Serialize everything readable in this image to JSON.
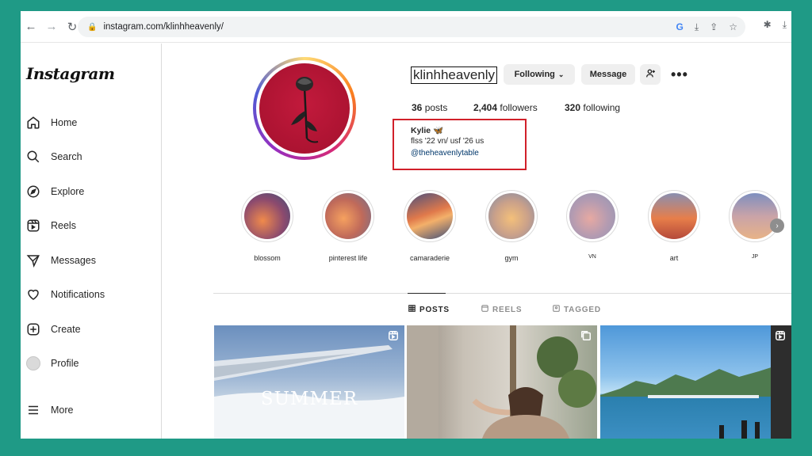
{
  "browser": {
    "url": "instagram.com/klinhheavenly/"
  },
  "app": {
    "logo": "Instagram"
  },
  "sidebar": {
    "items": [
      {
        "label": "Home",
        "icon": "home-icon"
      },
      {
        "label": "Search",
        "icon": "search-icon"
      },
      {
        "label": "Explore",
        "icon": "compass-icon"
      },
      {
        "label": "Reels",
        "icon": "reels-icon"
      },
      {
        "label": "Messages",
        "icon": "send-icon"
      },
      {
        "label": "Notifications",
        "icon": "heart-icon"
      },
      {
        "label": "Create",
        "icon": "plus-square-icon"
      },
      {
        "label": "Profile",
        "icon": "avatar-icon"
      },
      {
        "label": "More",
        "icon": "menu-icon"
      }
    ]
  },
  "profile": {
    "username": "klinhheavenly",
    "following_button": "Following",
    "message_button": "Message",
    "posts_count": "36",
    "posts_label": "posts",
    "followers_count": "2,404",
    "followers_label": "followers",
    "following_count": "320",
    "following_label": "following",
    "bio_name": "Kylie 🦋",
    "bio_line": "flss '22 vn/ usf '26 us",
    "bio_link": "@theheavenlytable"
  },
  "highlights": [
    {
      "label": "blossom"
    },
    {
      "label": "pinterest life"
    },
    {
      "label": "camaraderie"
    },
    {
      "label": "gym"
    },
    {
      "label": "VN"
    },
    {
      "label": "art"
    },
    {
      "label": "JP"
    }
  ],
  "tabs": [
    {
      "label": "POSTS",
      "active": true
    },
    {
      "label": "REELS",
      "active": false
    },
    {
      "label": "TAGGED",
      "active": false
    }
  ],
  "posts": [
    {
      "overlay_text": "SUMMER"
    },
    {
      "overlay_text": ""
    },
    {
      "overlay_text": ""
    }
  ],
  "colors": {
    "accent": "#1f9a86",
    "highlight_box": "#d1202a",
    "link": "#00376b"
  }
}
